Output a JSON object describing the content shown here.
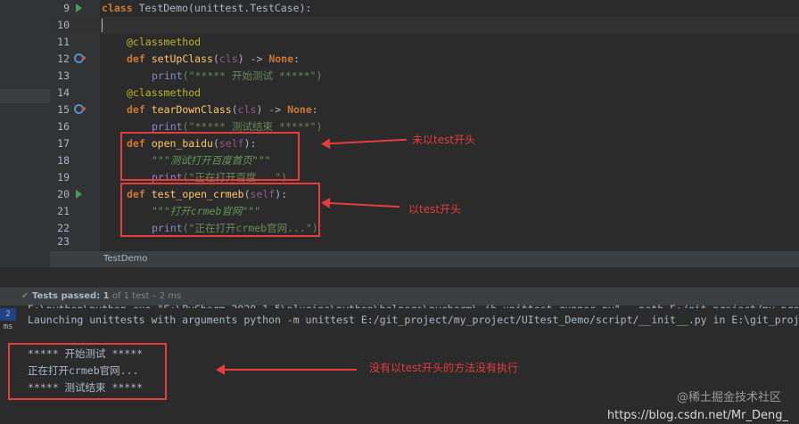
{
  "editor": {
    "lines": [
      {
        "num": "9"
      },
      {
        "num": "10"
      },
      {
        "num": "11"
      },
      {
        "num": "12"
      },
      {
        "num": "13"
      },
      {
        "num": "14"
      },
      {
        "num": "15"
      },
      {
        "num": "16"
      },
      {
        "num": "17"
      },
      {
        "num": "18"
      },
      {
        "num": "19"
      },
      {
        "num": "20"
      },
      {
        "num": "21"
      },
      {
        "num": "22"
      },
      {
        "num": "23"
      }
    ],
    "code": {
      "l9_kw": "class",
      "l9_name": "TestDemo",
      "l9_base": "(unittest.TestCase):",
      "l11": "@classmethod",
      "l12_def": "def",
      "l12_fn": "setUpClass",
      "l12_p1": "(",
      "l12_cls": "cls",
      "l12_p2": ") -> ",
      "l12_none": "None",
      "l12_colon": ":",
      "l13_print": "print",
      "l13_str": "(\"***** 开始测试 *****\")",
      "l14": "@classmethod",
      "l15_def": "def",
      "l15_fn": "tearDownClass",
      "l15_p1": "(",
      "l15_cls": "cls",
      "l15_p2": ") -> ",
      "l15_none": "None",
      "l15_colon": ":",
      "l16_print": "print",
      "l16_str": "(\"***** 测试结束 *****\")",
      "l17_def": "def",
      "l17_fn": "open_baidu",
      "l17_p1": "(",
      "l17_self": "self",
      "l17_p2": "):",
      "l18_doc": "\"\"\"测试打开百度首页\"\"\"",
      "l19_print": "print",
      "l19_str": "(\"正在打开百度...\")",
      "l20_def": "def",
      "l20_fn": "test_open_crmeb",
      "l20_p1": "(",
      "l20_self": "self",
      "l20_p2": "):",
      "l21_doc": "\"\"\"打开crmeb官网\"\"\"",
      "l22_print": "print",
      "l22_str": "(\"正在打开crmeb官网...\")"
    },
    "breadcrumb": "TestDemo"
  },
  "annotations": {
    "not_test": "未以test开头",
    "is_test": "以test开头",
    "not_executed": "没有以test开头的方法没有执行"
  },
  "run_panel": {
    "status_label": "Tests passed: 1",
    "status_detail": " of 1 test – 2 ms",
    "left_badge": "2 ms"
  },
  "console": {
    "line_partial": "E:\\python\\python.exe \"E:\\PyCharm 2020.1.5\\plugins\\python\\helpers\\pycharm\\_jb_unittest_runner.py\" --path E:/git_project/my_project/",
    "line_launch": "Launching unittests with arguments python -m unittest E:/git_project/my_project/UItest_Demo/script/__init__.py in E:\\git_proje",
    "out1": "***** 开始测试 *****",
    "out2": "正在打开crmeb官网...",
    "out3": "***** 测试结束 *****"
  },
  "watermark": {
    "site": "https://blog.csdn.net/Mr_Deng_",
    "community": "@稀土掘金技术社区"
  },
  "colors": {
    "keyword": "#cc7832",
    "function": "#ffc66d",
    "decorator": "#bbb529",
    "string": "#6a8759",
    "annotation_red": "#e53c3c",
    "background": "#2b2b2b"
  }
}
